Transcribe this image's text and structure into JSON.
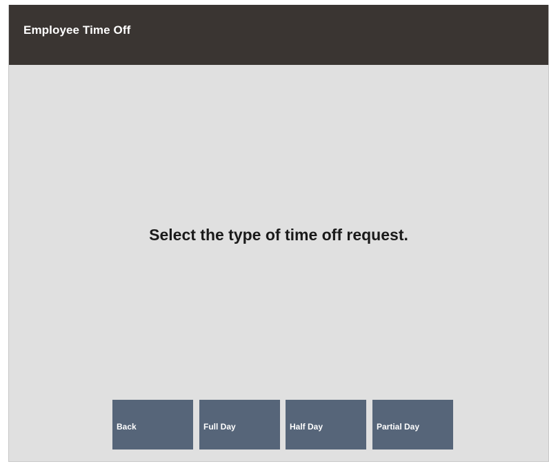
{
  "header": {
    "title": "Employee Time Off"
  },
  "main": {
    "prompt": "Select the type of time off request."
  },
  "buttons": {
    "back": "Back",
    "full_day": "Full Day",
    "half_day": "Half Day",
    "partial_day": "Partial Day"
  },
  "colors": {
    "header_bg": "#3a3532",
    "body_bg": "#e0e0e0",
    "button_bg": "#566579"
  }
}
